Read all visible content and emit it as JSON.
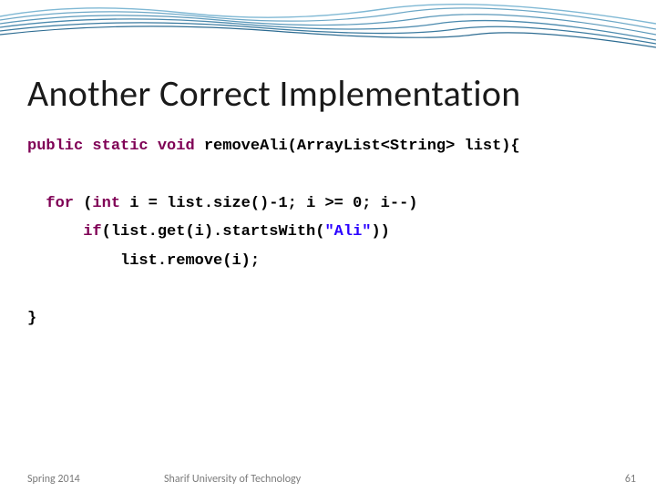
{
  "title": "Another Correct Implementation",
  "code": {
    "line1_kw1": "public",
    "line1_sp1": " ",
    "line1_kw2": "static",
    "line1_sp2": " ",
    "line1_kw3": "void",
    "line1_rest": " removeAli(ArrayList<String> list){",
    "blank1": "",
    "line2_indent": "  ",
    "line2_kw1": "for",
    "line2_mid1": " (",
    "line2_kw2": "int",
    "line2_rest": " i = list.size()-1; i >= 0; i--)",
    "line3_indent": "      ",
    "line3_kw1": "if",
    "line3_mid1": "(list.get(i).startsWith(",
    "line3_str": "\"Ali\"",
    "line3_end": "))",
    "line4_indent": "          ",
    "line4_rest": "list.remove(i);",
    "blank2": "",
    "line5": "}"
  },
  "footer": {
    "left": "Spring 2014",
    "center": "Sharif University of Technology",
    "right": "61"
  }
}
